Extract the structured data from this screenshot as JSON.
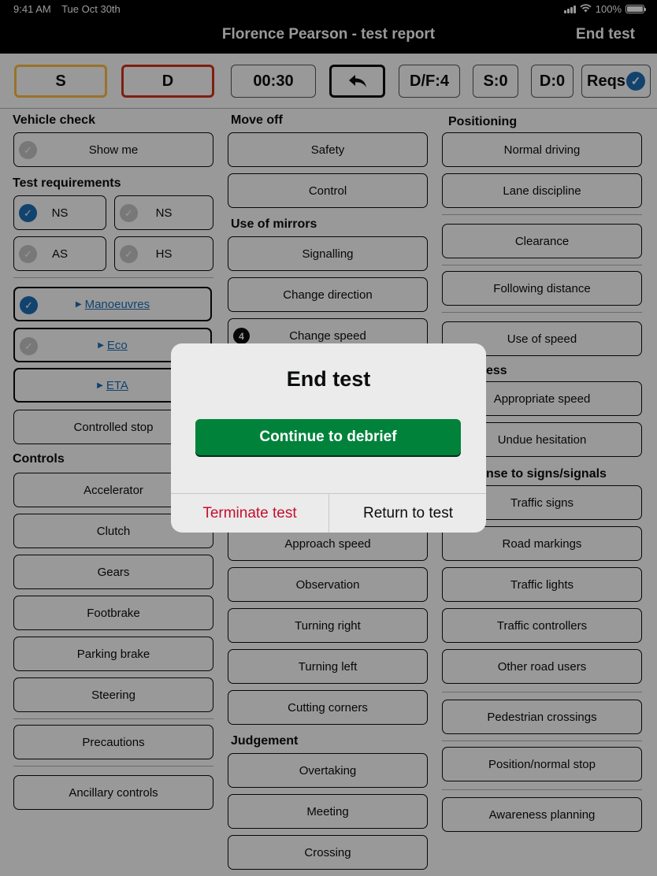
{
  "status_bar": {
    "time": "9:41 AM",
    "date": "Tue Oct 30th",
    "battery": "100%"
  },
  "nav": {
    "title": "Florence Pearson - test report",
    "end_test": "End test"
  },
  "toolbar": {
    "s": "S",
    "d": "D",
    "timer": "00:30",
    "df": "D/F:4",
    "serious": "S:0",
    "dangerous": "D:0",
    "reqs": "Reqs"
  },
  "col1": {
    "vehicle_check": "Vehicle check",
    "show_me": "Show me",
    "test_requirements": "Test requirements",
    "ns1": "NS",
    "ns2": "NS",
    "as": "AS",
    "hs": "HS",
    "manoeuvres": "Manoeuvres",
    "eco": "Eco",
    "eta": "ETA",
    "controlled_stop": "Controlled stop",
    "controls": "Controls",
    "accelerator": "Accelerator",
    "clutch": "Clutch",
    "gears": "Gears",
    "footbrake": "Footbrake",
    "parking_brake": "Parking brake",
    "steering": "Steering",
    "precautions": "Precautions",
    "ancillary_controls": "Ancillary controls"
  },
  "col2": {
    "move_off": "Move off",
    "safety": "Safety",
    "control": "Control",
    "use_of_mirrors": "Use of mirrors",
    "signalling": "Signalling",
    "change_direction": "Change direction",
    "change_speed": "Change speed",
    "change_speed_count": "4",
    "approach_speed": "Approach speed",
    "observation": "Observation",
    "turning_right": "Turning right",
    "turning_left": "Turning left",
    "cutting_corners": "Cutting corners",
    "judgement": "Judgement",
    "overtaking": "Overtaking",
    "meeting": "Meeting",
    "crossing": "Crossing"
  },
  "col3": {
    "positioning": "Positioning",
    "normal_driving": "Normal driving",
    "lane_discipline": "Lane discipline",
    "clearance": "Clearance",
    "following_distance": "Following distance",
    "use_of_speed": "Use of speed",
    "progress_partial": "ess",
    "appropriate_speed": "Appropriate speed",
    "undue_hesitation": "Undue hesitation",
    "response_partial": "nse to signs/signals",
    "traffic_signs": "Traffic signs",
    "road_markings": "Road markings",
    "traffic_lights": "Traffic lights",
    "traffic_controllers": "Traffic controllers",
    "other_road_users": "Other road users",
    "pedestrian_crossings": "Pedestrian crossings",
    "position_normal_stop": "Position/normal stop",
    "awareness_planning": "Awareness planning"
  },
  "modal": {
    "title": "End test",
    "continue": "Continue to debrief",
    "terminate": "Terminate test",
    "return": "Return to test"
  },
  "colors": {
    "accent": "#1d70b8",
    "continue": "#00823b",
    "terminate": "#c40f2e",
    "serious": "#ffbf47",
    "dangerous": "#d4351c"
  }
}
